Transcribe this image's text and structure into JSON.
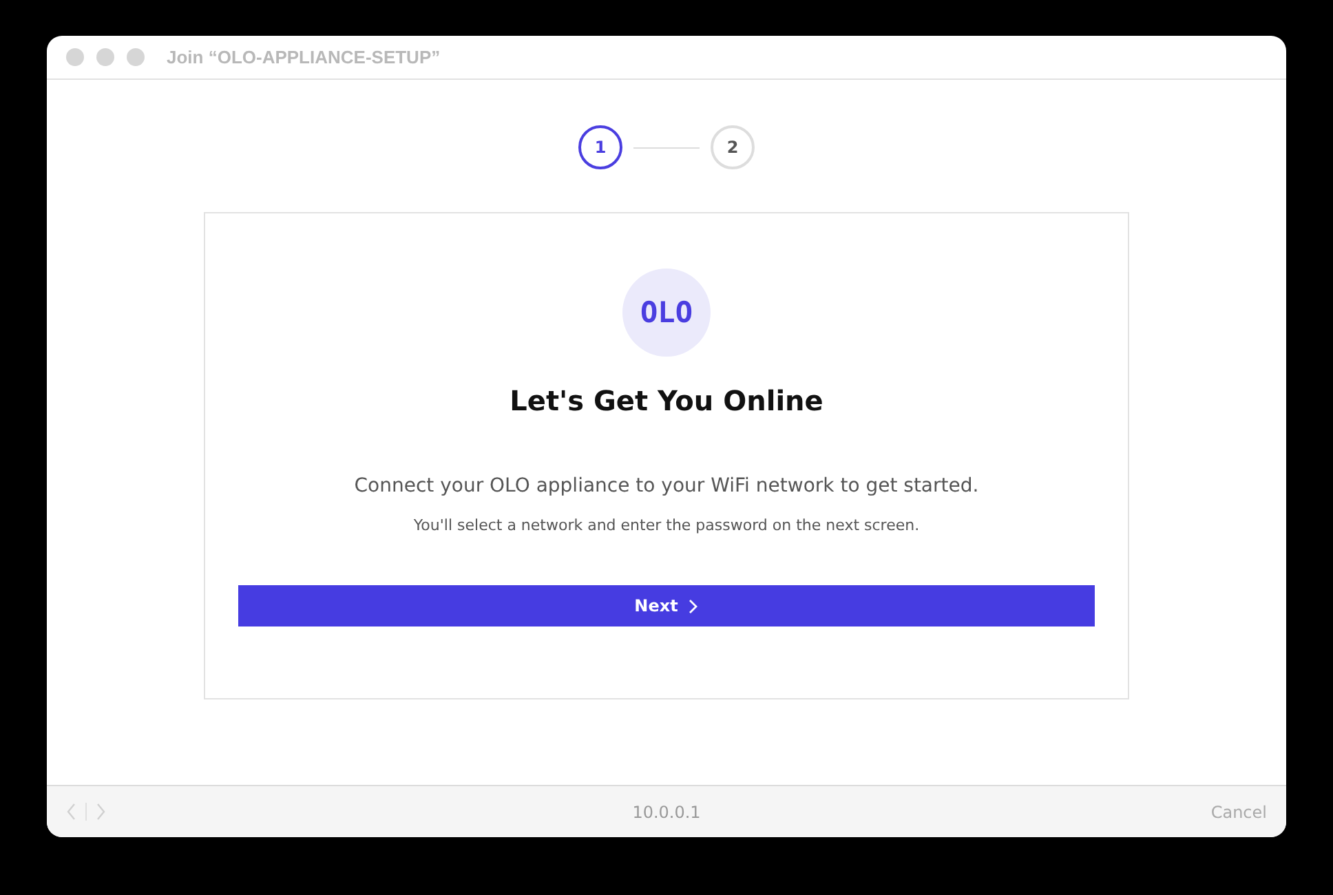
{
  "window": {
    "title": "Join “OLO-APPLIANCE-SETUP”"
  },
  "steps": [
    {
      "label": "1",
      "selected": true
    },
    {
      "label": "2",
      "selected": false
    }
  ],
  "card": {
    "logo": "OLO",
    "heading": "Let's Get You Online",
    "description": "Connect your OLO appliance to your WiFi network to get started.",
    "note": "You'll select a network and enter the password on the next screen.",
    "button": "Next"
  },
  "footer": {
    "address": "10.0.0.1",
    "cancel": "Cancel"
  }
}
